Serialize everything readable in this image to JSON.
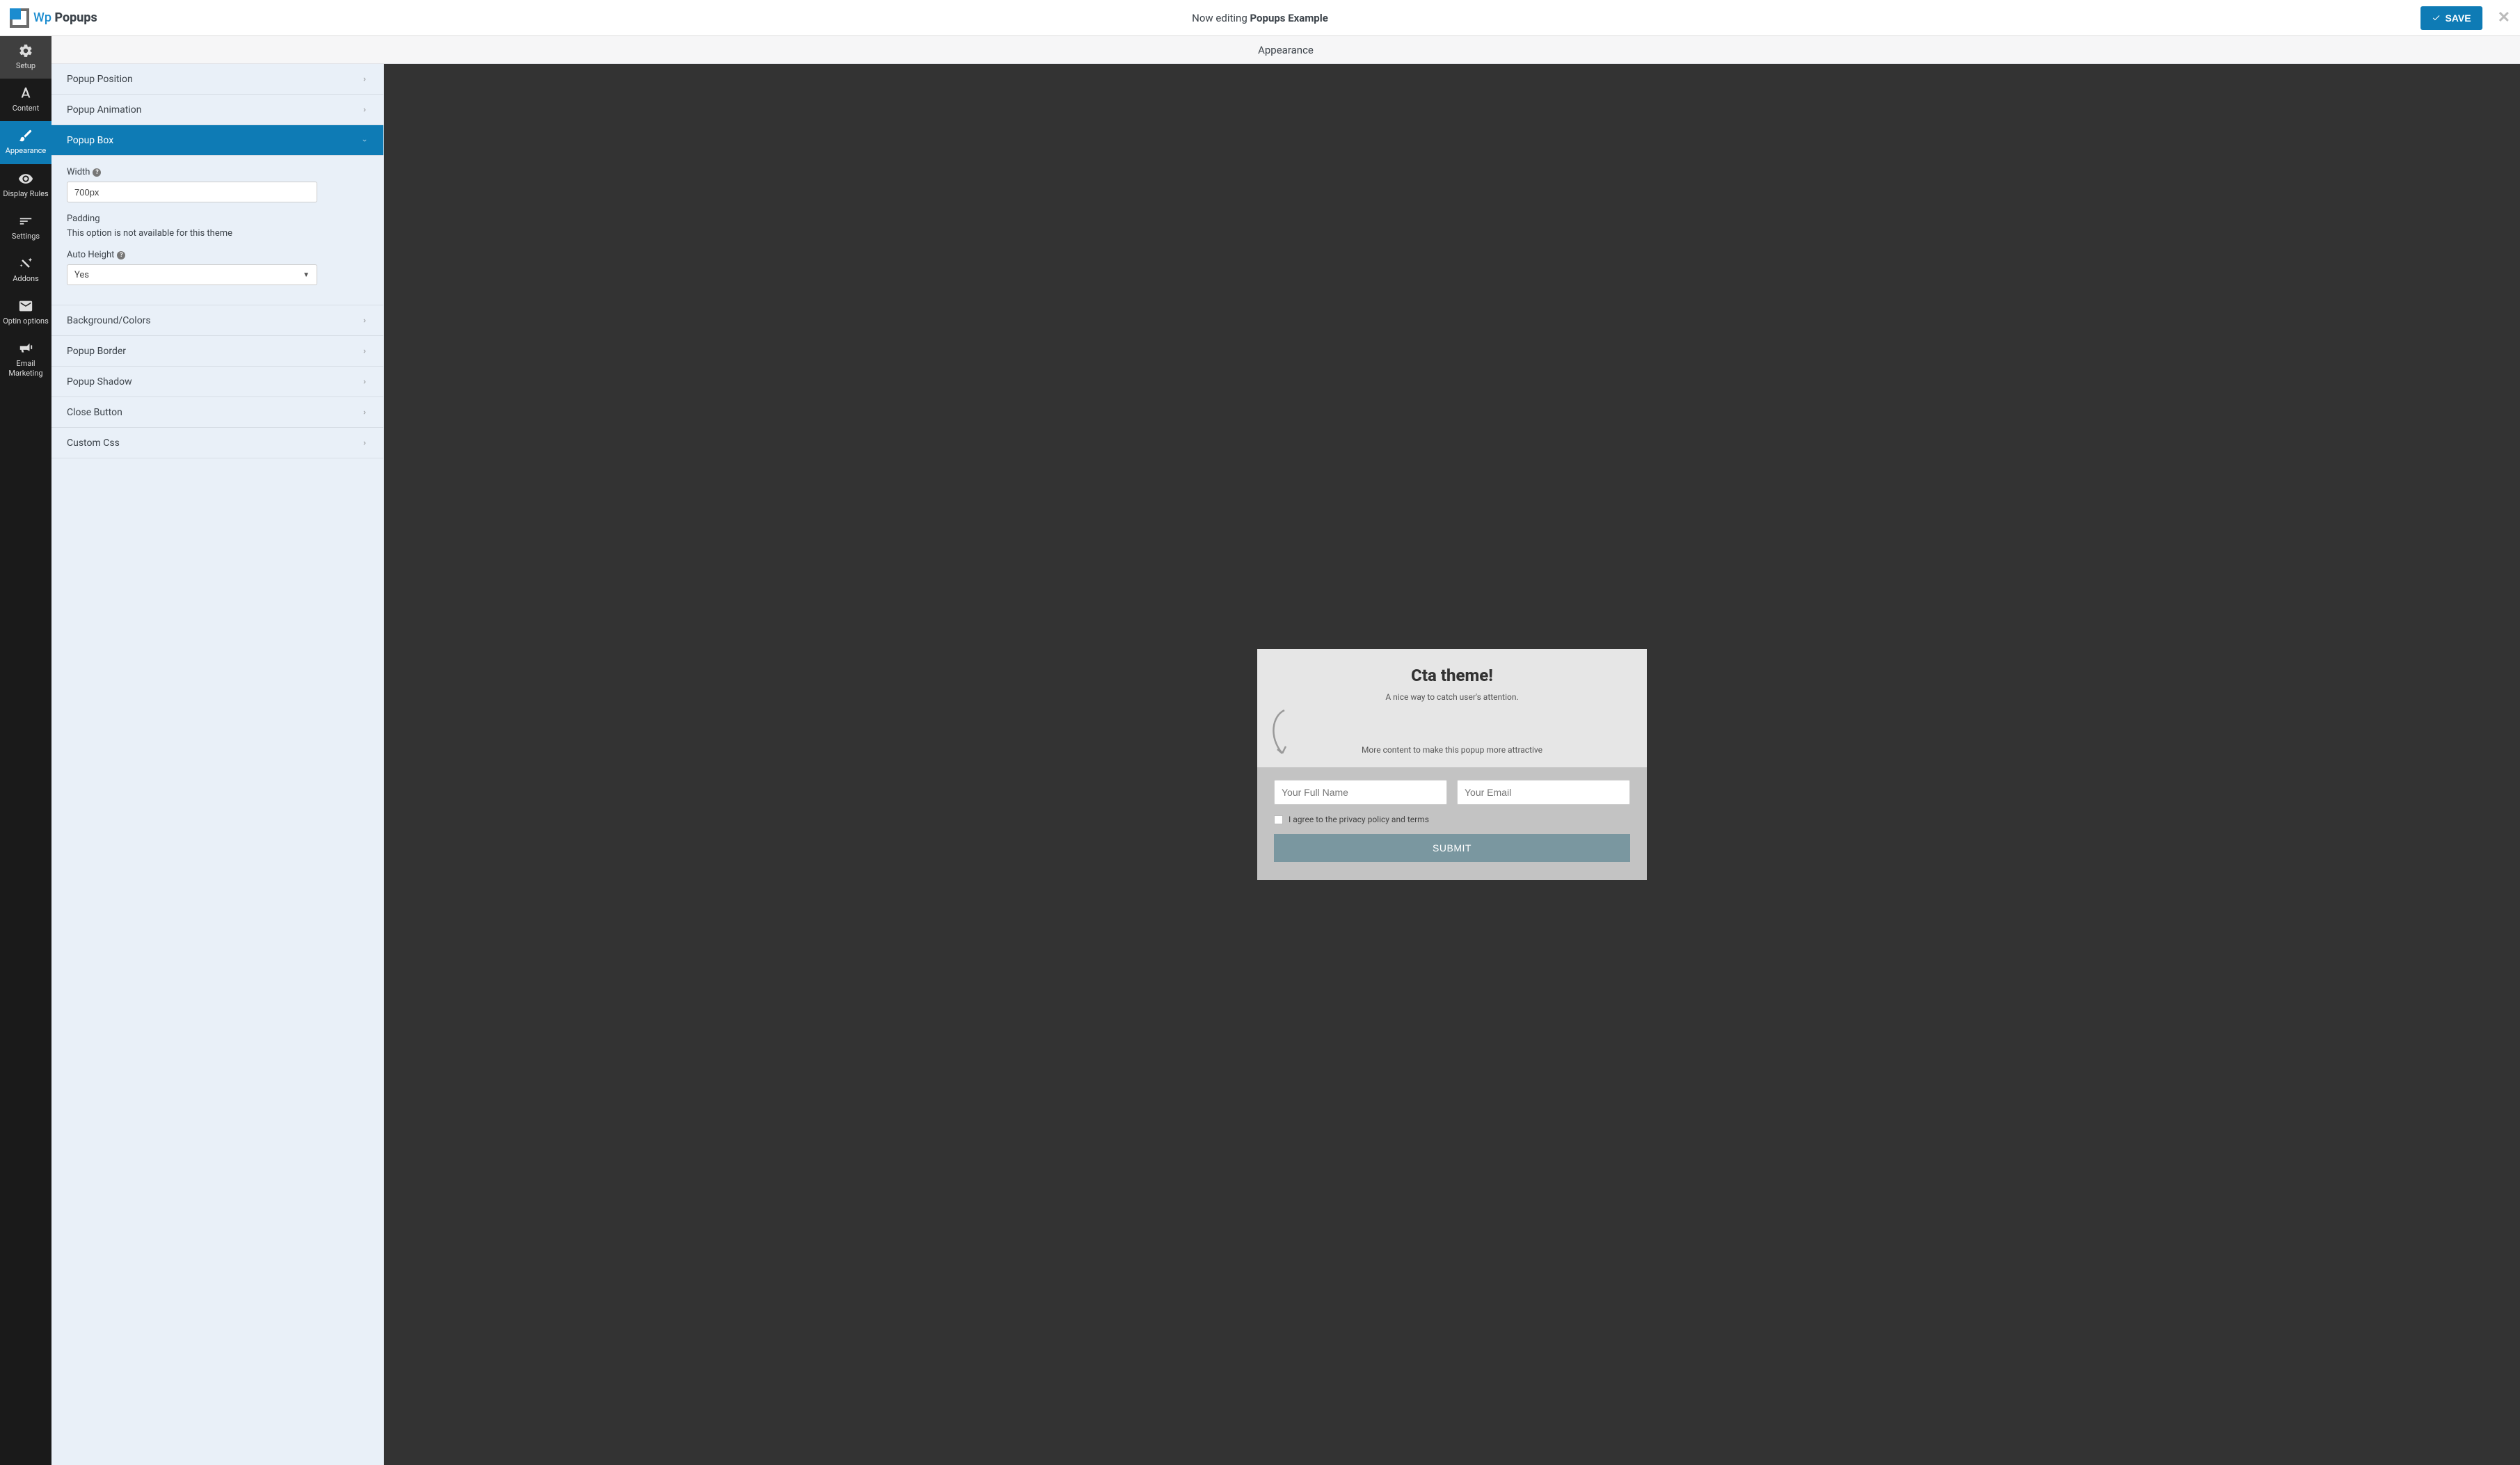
{
  "logo": {
    "wp": "Wp",
    "popups": "Popups"
  },
  "header": {
    "editing_prefix": "Now editing ",
    "editing_name": "Popups Example",
    "save": "SAVE"
  },
  "sidenav": [
    {
      "id": "setup",
      "label": "Setup"
    },
    {
      "id": "content",
      "label": "Content"
    },
    {
      "id": "appearance",
      "label": "Appearance"
    },
    {
      "id": "display-rules",
      "label": "Display Rules"
    },
    {
      "id": "settings",
      "label": "Settings"
    },
    {
      "id": "addons",
      "label": "Addons"
    },
    {
      "id": "optin",
      "label": "Optin options"
    },
    {
      "id": "email",
      "label": "Email Marketing"
    }
  ],
  "panel": {
    "title": "Appearance",
    "sections": {
      "position": "Popup Position",
      "animation": "Popup Animation",
      "box": "Popup Box",
      "bg": "Background/Colors",
      "border": "Popup Border",
      "shadow": "Popup Shadow",
      "close": "Close Button",
      "css": "Custom Css"
    },
    "box_fields": {
      "width_label": "Width",
      "width_value": "700px",
      "padding_label": "Padding",
      "padding_note": "This option is not available for this theme",
      "autoheight_label": "Auto Height",
      "autoheight_value": "Yes"
    }
  },
  "preview": {
    "title": "Cta theme!",
    "subtitle": "A nice way to catch user's attention.",
    "more": "More content to make this popup more attractive",
    "name_placeholder": "Your Full Name",
    "email_placeholder": "Your Email",
    "agree": "I agree to the privacy policy and terms",
    "submit": "SUBMIT"
  }
}
